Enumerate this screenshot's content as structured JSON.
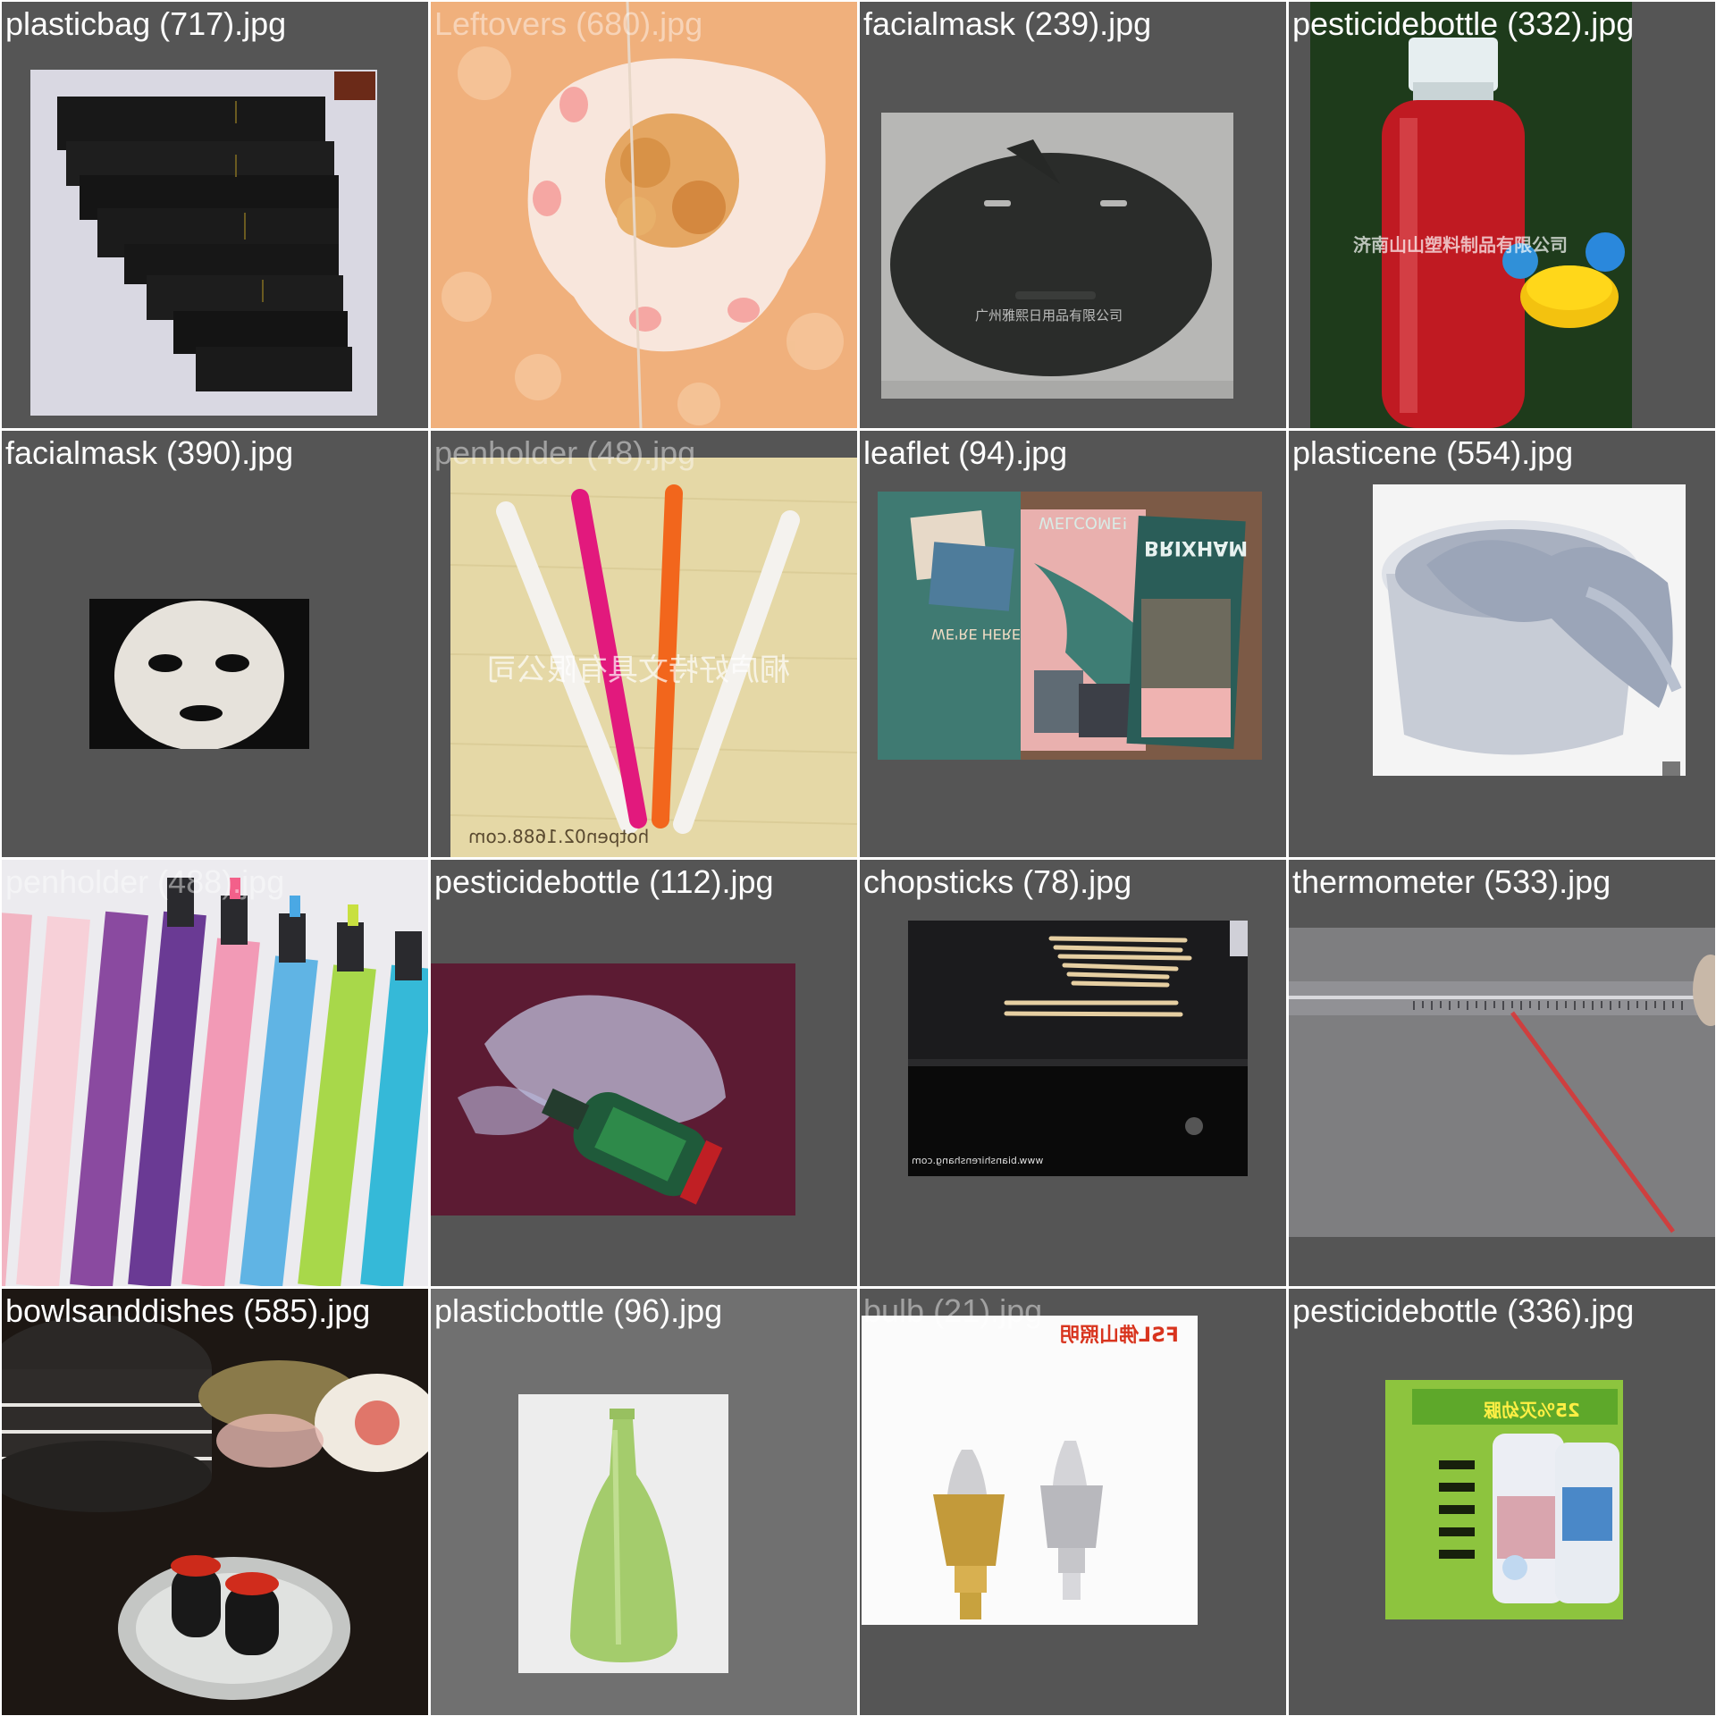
{
  "tiles": [
    {
      "caption": "plasticbag (717).jpg"
    },
    {
      "caption": "Leftovers (680).jpg"
    },
    {
      "caption": "facialmask (239).jpg",
      "watermark": "广州雅熙日用品有限公司"
    },
    {
      "caption": "pesticidebottle (332).jpg",
      "watermark": "济南山山塑料制品有限公司"
    },
    {
      "caption": "facialmask (390).jpg"
    },
    {
      "caption": "penholder (48).jpg",
      "watermark": "桐庐好特文具有限公司",
      "site": "hotpen02.1688.com"
    },
    {
      "caption": "leaflet (94).jpg",
      "text1": "WELCOME!",
      "text2": "BRIXHAM",
      "text3": "WE'RE HERE"
    },
    {
      "caption": "plasticene (554).jpg"
    },
    {
      "caption": "penholder (488).jpg"
    },
    {
      "caption": "pesticidebottle (112).jpg"
    },
    {
      "caption": "chopsticks (78).jpg",
      "site": "www.bianshirenshang.com"
    },
    {
      "caption": "thermometer (533).jpg"
    },
    {
      "caption": "bowlsanddishes (585).jpg"
    },
    {
      "caption": "plasticbottle (96).jpg"
    },
    {
      "caption": "bulb (21).jpg",
      "brand": "FSL佛山照明"
    },
    {
      "caption": "pesticidebottle (336).jpg",
      "text1": "25%灭幼脲"
    }
  ]
}
